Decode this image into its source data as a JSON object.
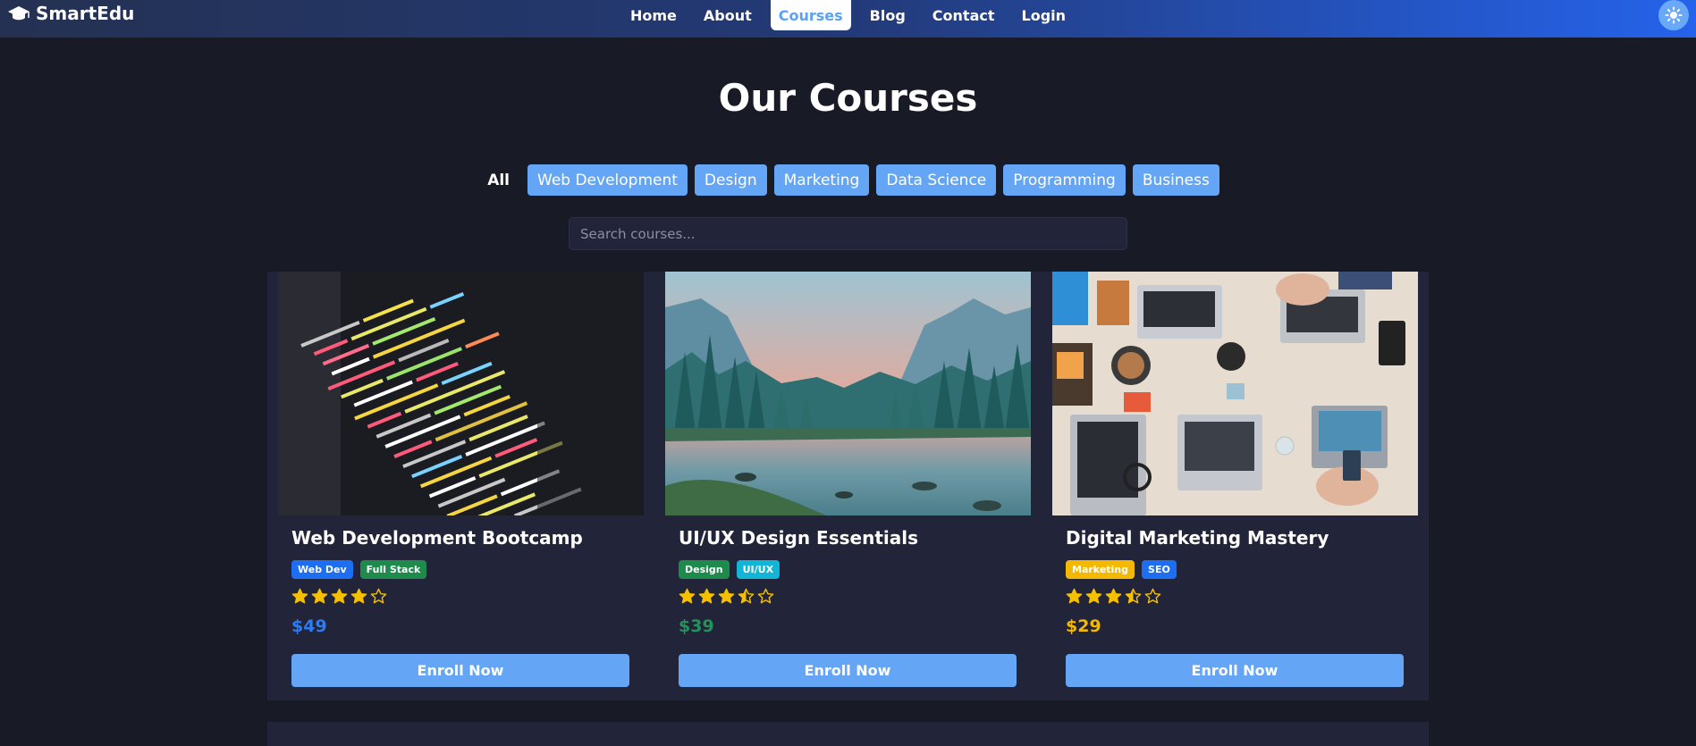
{
  "brand": {
    "name": "SmartEdu",
    "icon": "graduation-cap-icon"
  },
  "nav": {
    "items": [
      {
        "label": "Home",
        "active": false
      },
      {
        "label": "About",
        "active": false
      },
      {
        "label": "Courses",
        "active": true
      },
      {
        "label": "Blog",
        "active": false
      },
      {
        "label": "Contact",
        "active": false
      },
      {
        "label": "Login",
        "active": false
      }
    ],
    "theme_toggle_icon": "sun-icon"
  },
  "page": {
    "title": "Our Courses"
  },
  "filters": [
    {
      "label": "All",
      "active": true
    },
    {
      "label": "Web Development",
      "active": false
    },
    {
      "label": "Design",
      "active": false
    },
    {
      "label": "Marketing",
      "active": false
    },
    {
      "label": "Data Science",
      "active": false
    },
    {
      "label": "Programming",
      "active": false
    },
    {
      "label": "Business",
      "active": false
    }
  ],
  "search": {
    "placeholder": "Search courses...",
    "value": ""
  },
  "courses": [
    {
      "title": "Web Development Bootcamp",
      "image": "code-editor-photo",
      "badges": [
        {
          "label": "Web Dev",
          "color": "#1d6ef0"
        },
        {
          "label": "Full Stack",
          "color": "#1e8a4c"
        }
      ],
      "rating": 4,
      "price": "$49",
      "price_color": "#2f7bf0",
      "cta": "Enroll Now"
    },
    {
      "title": "UI/UX Design Essentials",
      "image": "mountain-lake-photo",
      "badges": [
        {
          "label": "Design",
          "color": "#1e8a4c"
        },
        {
          "label": "UI/UX",
          "color": "#12b5d6"
        }
      ],
      "rating": 3.5,
      "price": "$39",
      "price_color": "#23935a",
      "cta": "Enroll Now"
    },
    {
      "title": "Digital Marketing Mastery",
      "image": "desk-laptops-photo",
      "badges": [
        {
          "label": "Marketing",
          "color": "#f5b800"
        },
        {
          "label": "SEO",
          "color": "#1d6ef0"
        }
      ],
      "rating": 3.5,
      "price": "$29",
      "price_color": "#f5b800",
      "cta": "Enroll Now"
    }
  ],
  "colors": {
    "background": "#181a25",
    "card": "#22243a",
    "accent": "#64a5f6",
    "star": "#f5c000"
  }
}
